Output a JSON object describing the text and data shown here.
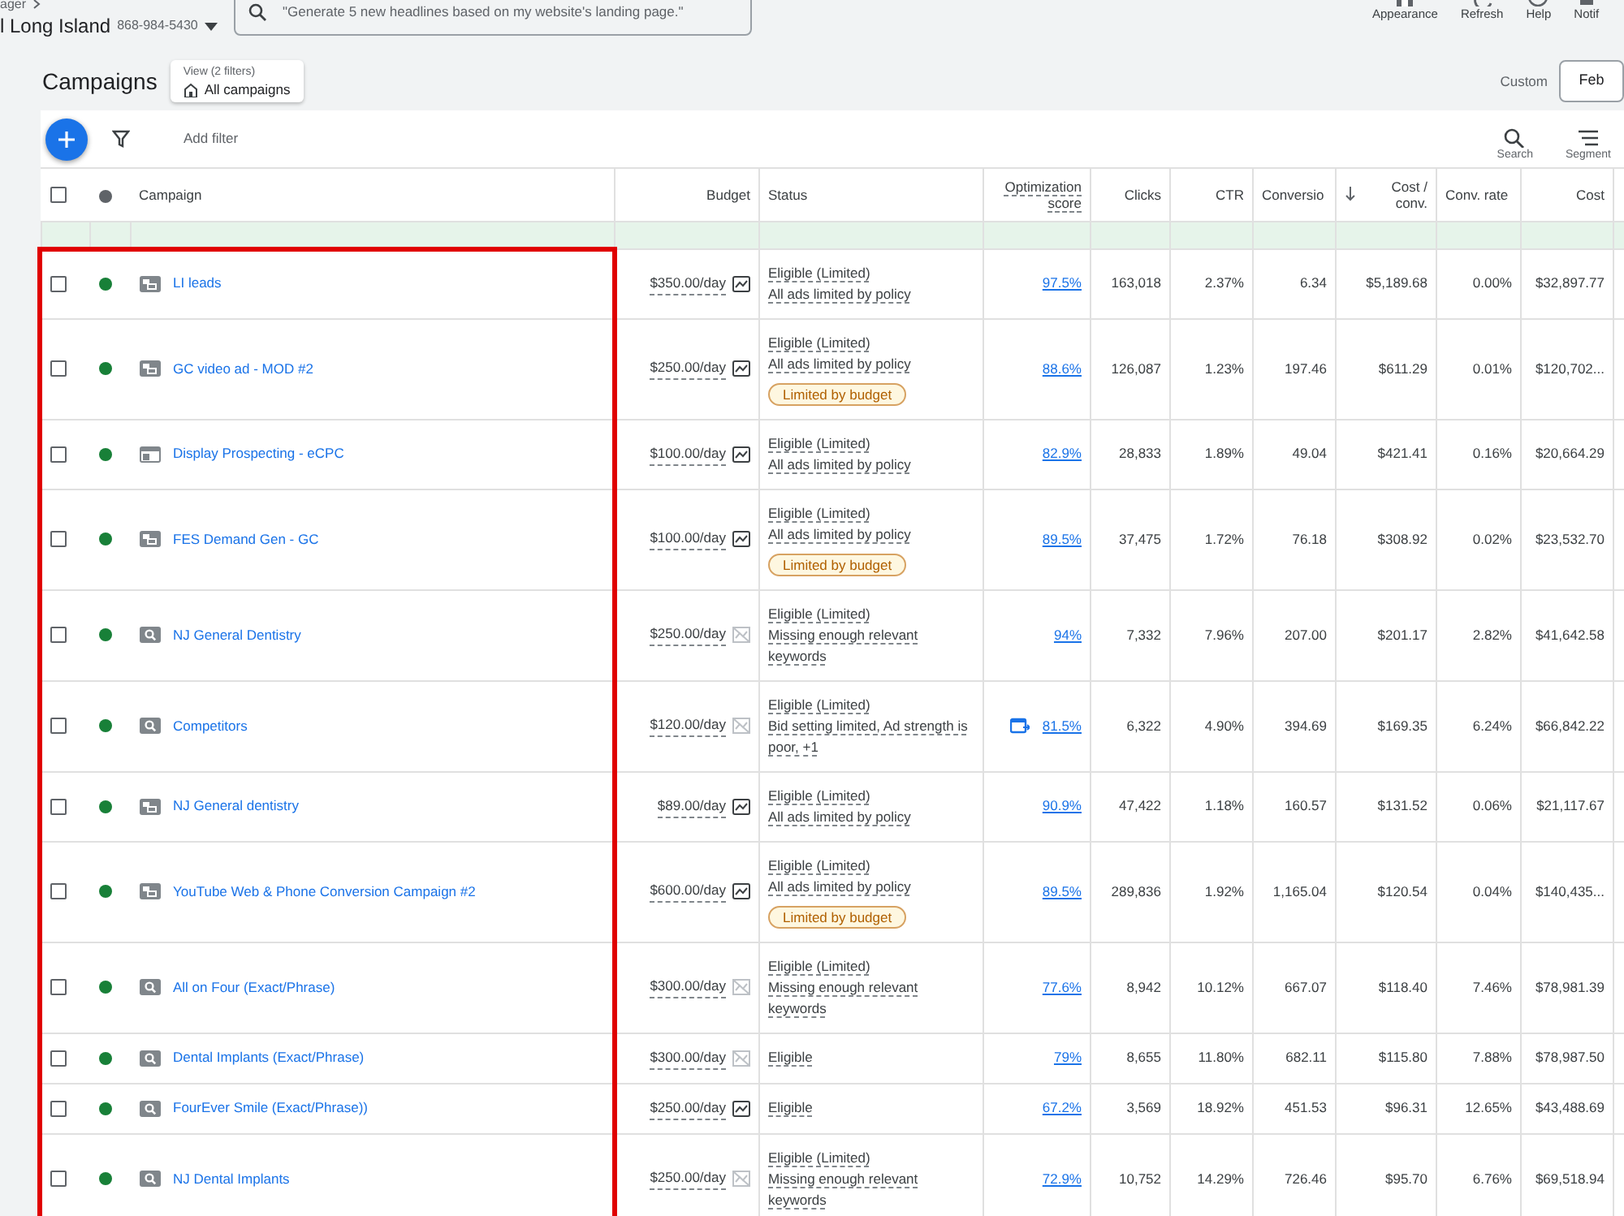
{
  "header": {
    "breadcrumb": "ager",
    "account_name": "l Long Island",
    "account_id": "868-984-5430",
    "search": {
      "placeholder": "\"Generate 5 new headlines based on my website's landing page.\""
    },
    "actions": [
      {
        "kind": "appearance",
        "label": "Appearance"
      },
      {
        "kind": "refresh",
        "label": "Refresh"
      },
      {
        "kind": "help",
        "label": "Help"
      },
      {
        "kind": "notifications",
        "label": "Notif"
      }
    ]
  },
  "page": {
    "title": "Campaigns",
    "view_label": "View (2 filters)",
    "view_value": "All campaigns",
    "date_label": "Custom",
    "date_value": "Feb"
  },
  "toolbar": {
    "add_filter": "Add filter",
    "actions": [
      {
        "kind": "search",
        "label": "Search"
      },
      {
        "kind": "segment",
        "label": "Segment"
      }
    ]
  },
  "table": {
    "select_all": {
      "checked": false
    },
    "columns": [
      {
        "label": "Campaign"
      },
      {
        "label": "Budget"
      },
      {
        "label": "Status"
      },
      {
        "label": "Optimization score",
        "dotted": true
      },
      {
        "label": "Clicks"
      },
      {
        "label": "CTR"
      },
      {
        "label": "Conversio"
      },
      {
        "label": "Cost / conv.",
        "sorted": true
      },
      {
        "label": "Conv. rate"
      },
      {
        "label": "Cost"
      }
    ],
    "highlight_campaigns": true,
    "rows": [
      {
        "selected": false,
        "color": "#188038",
        "kind": "video",
        "name": "LI leads",
        "budget": "$350.00/day",
        "trend": true,
        "status": "Eligible (Limited)",
        "detail": "All ads limited by policy",
        "opt": "97.5%",
        "clicks": "163,018",
        "ctr": "2.37%",
        "conv": "6.34",
        "cost_conv": "$5,189.68",
        "conv_rate": "0.00%",
        "cost": "$32,897.77"
      },
      {
        "selected": false,
        "color": "#188038",
        "kind": "video",
        "name": "GC video ad - MOD #2",
        "budget": "$250.00/day",
        "trend": true,
        "status": "Eligible (Limited)",
        "detail": "All ads limited by policy",
        "badge": "Limited by budget",
        "opt": "88.6%",
        "clicks": "126,087",
        "ctr": "1.23%",
        "conv": "197.46",
        "cost_conv": "$611.29",
        "conv_rate": "0.01%",
        "cost": "$120,702..."
      },
      {
        "selected": false,
        "color": "#188038",
        "kind": "display",
        "name": "Display Prospecting - eCPC",
        "budget": "$100.00/day",
        "trend": true,
        "status": "Eligible (Limited)",
        "detail": "All ads limited by policy",
        "opt": "82.9%",
        "clicks": "28,833",
        "ctr": "1.89%",
        "conv": "49.04",
        "cost_conv": "$421.41",
        "conv_rate": "0.16%",
        "cost": "$20,664.29"
      },
      {
        "selected": false,
        "color": "#188038",
        "kind": "video",
        "name": "FES Demand Gen - GC",
        "budget": "$100.00/day",
        "trend": true,
        "status": "Eligible (Limited)",
        "detail": "All ads limited by policy",
        "badge": "Limited by budget",
        "opt": "89.5%",
        "clicks": "37,475",
        "ctr": "1.72%",
        "conv": "76.18",
        "cost_conv": "$308.92",
        "conv_rate": "0.02%",
        "cost": "$23,532.70"
      },
      {
        "selected": false,
        "color": "#188038",
        "kind": "search",
        "name": "NJ General Dentistry",
        "budget": "$250.00/day",
        "trend": false,
        "status": "Eligible (Limited)",
        "detail": "Missing enough relevant keywords",
        "opt": "94%",
        "clicks": "7,332",
        "ctr": "7.96%",
        "conv": "207.00",
        "cost_conv": "$201.17",
        "conv_rate": "2.82%",
        "cost": "$41,642.58"
      },
      {
        "selected": false,
        "color": "#188038",
        "kind": "search",
        "name": "Competitors",
        "budget": "$120.00/day",
        "trend": false,
        "status": "Eligible (Limited)",
        "detail": "Bid setting limited, Ad strength is poor, +1",
        "opt": "81.5%",
        "opt_recommendation": true,
        "clicks": "6,322",
        "ctr": "4.90%",
        "conv": "394.69",
        "cost_conv": "$169.35",
        "conv_rate": "6.24%",
        "cost": "$66,842.22"
      },
      {
        "selected": false,
        "color": "#188038",
        "kind": "video",
        "name": "NJ General dentistry",
        "budget": "$89.00/day",
        "trend": true,
        "status": "Eligible (Limited)",
        "detail": "All ads limited by policy",
        "opt": "90.9%",
        "clicks": "47,422",
        "ctr": "1.18%",
        "conv": "160.57",
        "cost_conv": "$131.52",
        "conv_rate": "0.06%",
        "cost": "$21,117.67"
      },
      {
        "selected": false,
        "color": "#188038",
        "kind": "video",
        "name": "YouTube Web & Phone Conversion Campaign #2",
        "budget": "$600.00/day",
        "trend": true,
        "status": "Eligible (Limited)",
        "detail": "All ads limited by policy",
        "badge": "Limited by budget",
        "opt": "89.5%",
        "clicks": "289,836",
        "ctr": "1.92%",
        "conv": "1,165.04",
        "cost_conv": "$120.54",
        "conv_rate": "0.04%",
        "cost": "$140,435..."
      },
      {
        "selected": false,
        "color": "#188038",
        "kind": "search",
        "name": "All on Four (Exact/Phrase)",
        "budget": "$300.00/day",
        "trend": false,
        "status": "Eligible (Limited)",
        "detail": "Missing enough relevant keywords",
        "opt": "77.6%",
        "clicks": "8,942",
        "ctr": "10.12%",
        "conv": "667.07",
        "cost_conv": "$118.40",
        "conv_rate": "7.46%",
        "cost": "$78,981.39"
      },
      {
        "selected": false,
        "color": "#188038",
        "kind": "search",
        "name": "Dental Implants (Exact/Phrase)",
        "budget": "$300.00/day",
        "trend": false,
        "status": "Eligible",
        "opt": "79%",
        "clicks": "8,655",
        "ctr": "11.80%",
        "conv": "682.11",
        "cost_conv": "$115.80",
        "conv_rate": "7.88%",
        "cost": "$78,987.50"
      },
      {
        "selected": false,
        "color": "#188038",
        "kind": "search",
        "name": "FourEver Smile (Exact/Phrase))",
        "budget": "$250.00/day",
        "trend": true,
        "status": "Eligible",
        "opt": "67.2%",
        "clicks": "3,569",
        "ctr": "18.92%",
        "conv": "451.53",
        "cost_conv": "$96.31",
        "conv_rate": "12.65%",
        "cost": "$43,488.69"
      },
      {
        "selected": false,
        "color": "#188038",
        "kind": "search",
        "name": "NJ Dental Implants",
        "budget": "$250.00/day",
        "trend": false,
        "status": "Eligible (Limited)",
        "detail": "Missing enough relevant keywords",
        "opt": "72.9%",
        "clicks": "10,752",
        "ctr": "14.29%",
        "conv": "726.46",
        "cost_conv": "$95.70",
        "conv_rate": "6.76%",
        "cost": "$69,518.94"
      }
    ]
  }
}
